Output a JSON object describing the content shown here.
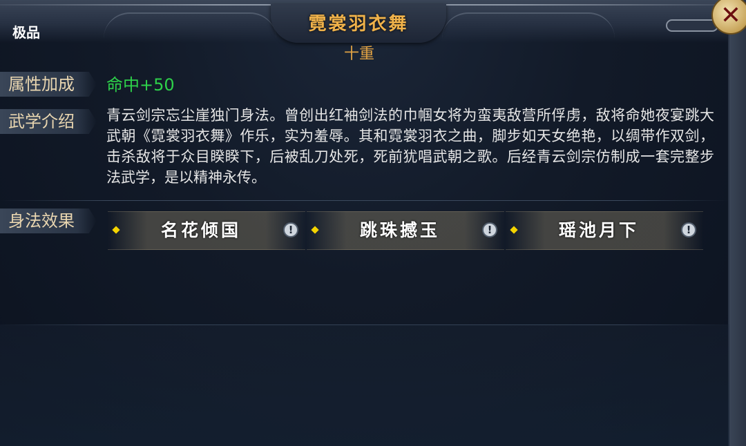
{
  "header": {
    "title": "霓裳羽衣舞",
    "rank": "极品",
    "level": "十重",
    "close_icon": "✕"
  },
  "attributes": {
    "label": "属性加成",
    "value": "命中+50",
    "value_color": "#2ed14a"
  },
  "description": {
    "label": "武学介绍",
    "text": "青云剑宗忘尘崖独门身法。曾创出红袖剑法的巾帼女将为蛮夷敌营所俘虏，敌将命她夜宴跳大武朝《霓裳羽衣舞》作乐，实为羞辱。其和霓裳羽衣之曲，脚步如天女绝艳，以绸带作双剑，击杀敌将于众目睽睽下，后被乱刀处死，死前犹唱武朝之歌。后经青云剑宗仿制成一套完整步法武学，是以精神永传。"
  },
  "effects": {
    "label": "身法效果",
    "items": [
      {
        "name": "名花倾国",
        "info_icon": "!"
      },
      {
        "name": "跳珠撼玉",
        "info_icon": "!"
      },
      {
        "name": "瑶池月下",
        "info_icon": "!"
      }
    ]
  },
  "colors": {
    "title": "#f0b24a",
    "label_text": "#e9d6b0",
    "diamond": "#f4d400"
  }
}
